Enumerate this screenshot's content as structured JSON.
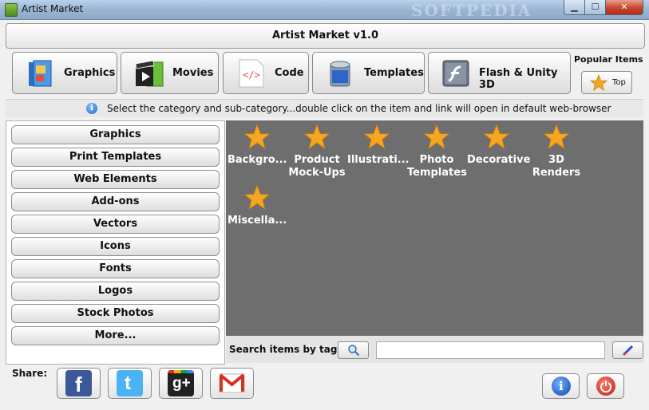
{
  "window": {
    "title": "Artist Market",
    "watermark": "SOFTPEDIA"
  },
  "header": {
    "title": "Artist Market v1.0"
  },
  "categories": [
    {
      "label": "Graphics",
      "icon": "book-icon"
    },
    {
      "label": "Movies",
      "icon": "film-clapper-icon"
    },
    {
      "label": "Code",
      "icon": "code-document-icon"
    },
    {
      "label": "Templates",
      "icon": "paint-bucket-icon"
    },
    {
      "label": "Flash & Unity 3D",
      "icon": "flash-icon"
    }
  ],
  "popular": {
    "label": "Popular Items",
    "top_label": "Top"
  },
  "info": {
    "text": "Select the category and sub-category...double click on the item and link will open in default web-browser"
  },
  "sidebar": {
    "items": [
      "Graphics",
      "Print Templates",
      "Web Elements",
      "Add-ons",
      "Vectors",
      "Icons",
      "Fonts",
      "Logos",
      "Stock Photos",
      "More..."
    ]
  },
  "content": {
    "items": [
      {
        "label": "Backgro..."
      },
      {
        "label": "Product Mock-Ups"
      },
      {
        "label": "Illustrati..."
      },
      {
        "label": "Photo Templates"
      },
      {
        "label": "Decorative"
      },
      {
        "label": "3D Renders"
      },
      {
        "label": "Miscella..."
      }
    ]
  },
  "search": {
    "label": "Search items by tags",
    "value": ""
  },
  "share": {
    "label": "Share:"
  },
  "colors": {
    "star": "#f5a623",
    "content_bg": "#6e6e6e",
    "facebook": "#3b5998",
    "twitter": "#4ab3f4",
    "google": "#222222",
    "gmail": "#d93025"
  }
}
